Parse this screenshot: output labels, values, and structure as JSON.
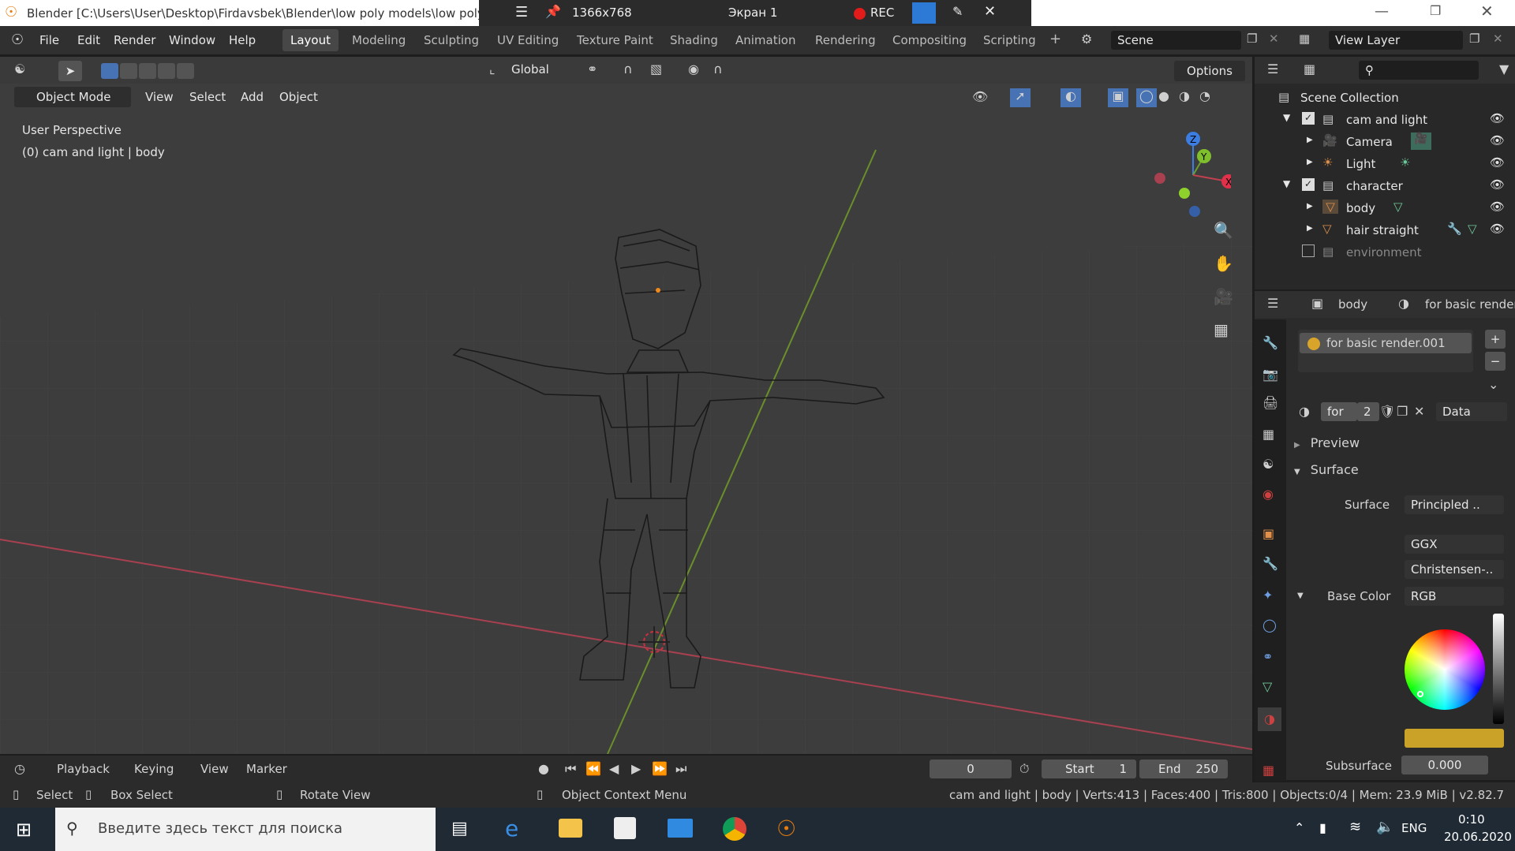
{
  "window": {
    "title": "Blender [C:\\Users\\User\\Desktop\\Firdavsbek\\Blender\\low poly models\\low poly c",
    "recorder": {
      "resolution": "1366x768",
      "screen": "Экран 1",
      "rec": "REC"
    }
  },
  "menubar": {
    "items": [
      "File",
      "Edit",
      "Render",
      "Window",
      "Help"
    ],
    "workspaces": [
      "Layout",
      "Modeling",
      "Sculpting",
      "UV Editing",
      "Texture Paint",
      "Shading",
      "Animation",
      "Rendering",
      "Compositing",
      "Scripting"
    ],
    "active_workspace": "Layout",
    "scene": "Scene",
    "view_layer": "View Layer"
  },
  "viewport": {
    "orientation": "Global",
    "options": "Options",
    "mode": "Object Mode",
    "header_menus": [
      "View",
      "Select",
      "Add",
      "Object"
    ],
    "overlay_title": "User Perspective",
    "overlay_sub": "(0) cam and light | body",
    "gizmo_axes": {
      "x": "X",
      "y": "Y",
      "z": "Z"
    }
  },
  "outliner": {
    "root": "Scene Collection",
    "rows": [
      {
        "label": "cam and light",
        "type": "collection"
      },
      {
        "label": "Camera",
        "type": "camera"
      },
      {
        "label": "Light",
        "type": "light"
      },
      {
        "label": "character",
        "type": "collection"
      },
      {
        "label": "body",
        "type": "mesh"
      },
      {
        "label": "hair straight",
        "type": "mesh"
      },
      {
        "label": "environment",
        "type": "collection-disabled"
      }
    ]
  },
  "properties": {
    "object": "body",
    "material_header": "for basic render.",
    "slot": "for basic render.001",
    "mat_name": "for",
    "users": "2",
    "link": "Data",
    "preview": "Preview",
    "surface_section": "Surface",
    "surface_label": "Surface",
    "surface_value": "Principled ..",
    "distribution": "GGX",
    "subsurface_method": "Christensen-..",
    "base_color_label": "Base Color",
    "base_color_mode": "RGB",
    "base_color_hex": "#c9a227",
    "subsurface_label": "Subsurface",
    "subsurface_value": "0.000"
  },
  "timeline": {
    "menus": [
      "Playback",
      "Keying",
      "View",
      "Marker"
    ],
    "current_frame": "0",
    "start_label": "Start",
    "start": "1",
    "end_label": "End",
    "end": "250"
  },
  "statusbar": {
    "select": "Select",
    "box_select": "Box Select",
    "rotate": "Rotate View",
    "context": "Object Context Menu",
    "stats": "cam and light | body | Verts:413 | Faces:400 | Tris:800 | Objects:0/4 | Mem: 23.9 MiB | v2.82.7"
  },
  "taskbar": {
    "search_placeholder": "Введите здесь текст для поиска",
    "lang": "ENG",
    "time": "0:10",
    "date": "20.06.2020"
  },
  "colors": {
    "accent": "#4772b3",
    "x_axis": "#c0404f",
    "y_axis": "#6b9e2c",
    "z_axis": "#3b7de0"
  }
}
